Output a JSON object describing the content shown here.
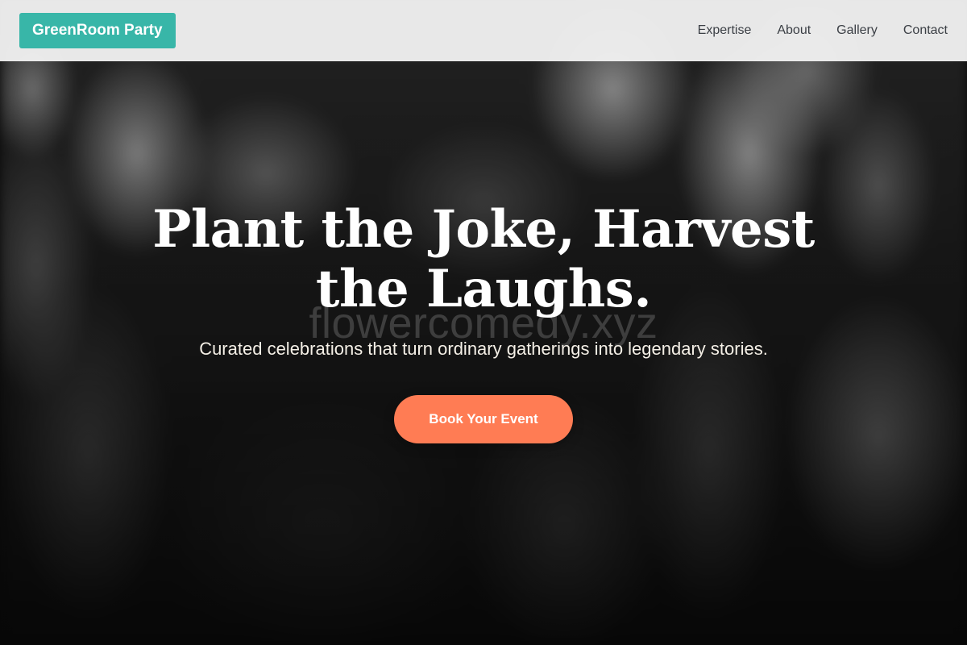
{
  "header": {
    "brand": "GreenRoom Party",
    "nav": [
      {
        "label": "Expertise"
      },
      {
        "label": "About"
      },
      {
        "label": "Gallery"
      },
      {
        "label": "Contact"
      }
    ]
  },
  "hero": {
    "title": "Plant the Joke, Harvest the Laughs.",
    "watermark": "flowercomedy.xyz",
    "subtitle": "Curated celebrations that turn ordinary gatherings into legendary stories.",
    "cta_label": "Book Your Event"
  },
  "colors": {
    "brand": "#38b6a8",
    "cta": "#ff7c54",
    "header_bg": "#f0f0f0",
    "nav_text": "#3b3f45"
  }
}
